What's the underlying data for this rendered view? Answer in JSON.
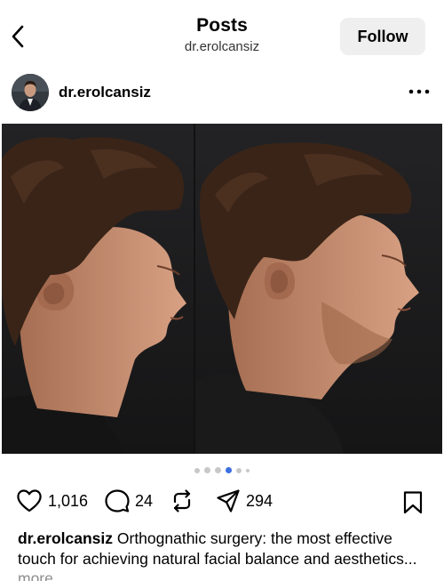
{
  "header": {
    "title": "Posts",
    "subtitle": "dr.erolcansiz",
    "follow_label": "Follow"
  },
  "post": {
    "username": "dr.erolcansiz",
    "image_description": "Side-by-side profile photos of a young man with curly hair showing jawline",
    "carousel": {
      "total": 6,
      "active_index": 3
    },
    "likes": "1,016",
    "comments": "24",
    "shares": "294",
    "caption": {
      "username": "dr.erolcansiz",
      "text": "Orthognathic surgery: the most effective touch for achieving natural facial balance and aesthetics...",
      "more_label": "more"
    }
  },
  "colors": {
    "follow_bg": "#efefef",
    "active_dot": "#3b82f6",
    "inactive_dot": "#c8c8c8",
    "muted_text": "#8e8e8e"
  },
  "icons": [
    "chevron-left-icon",
    "more-horizontal-icon",
    "heart-icon",
    "comment-icon",
    "repost-icon",
    "send-icon",
    "bookmark-icon"
  ]
}
